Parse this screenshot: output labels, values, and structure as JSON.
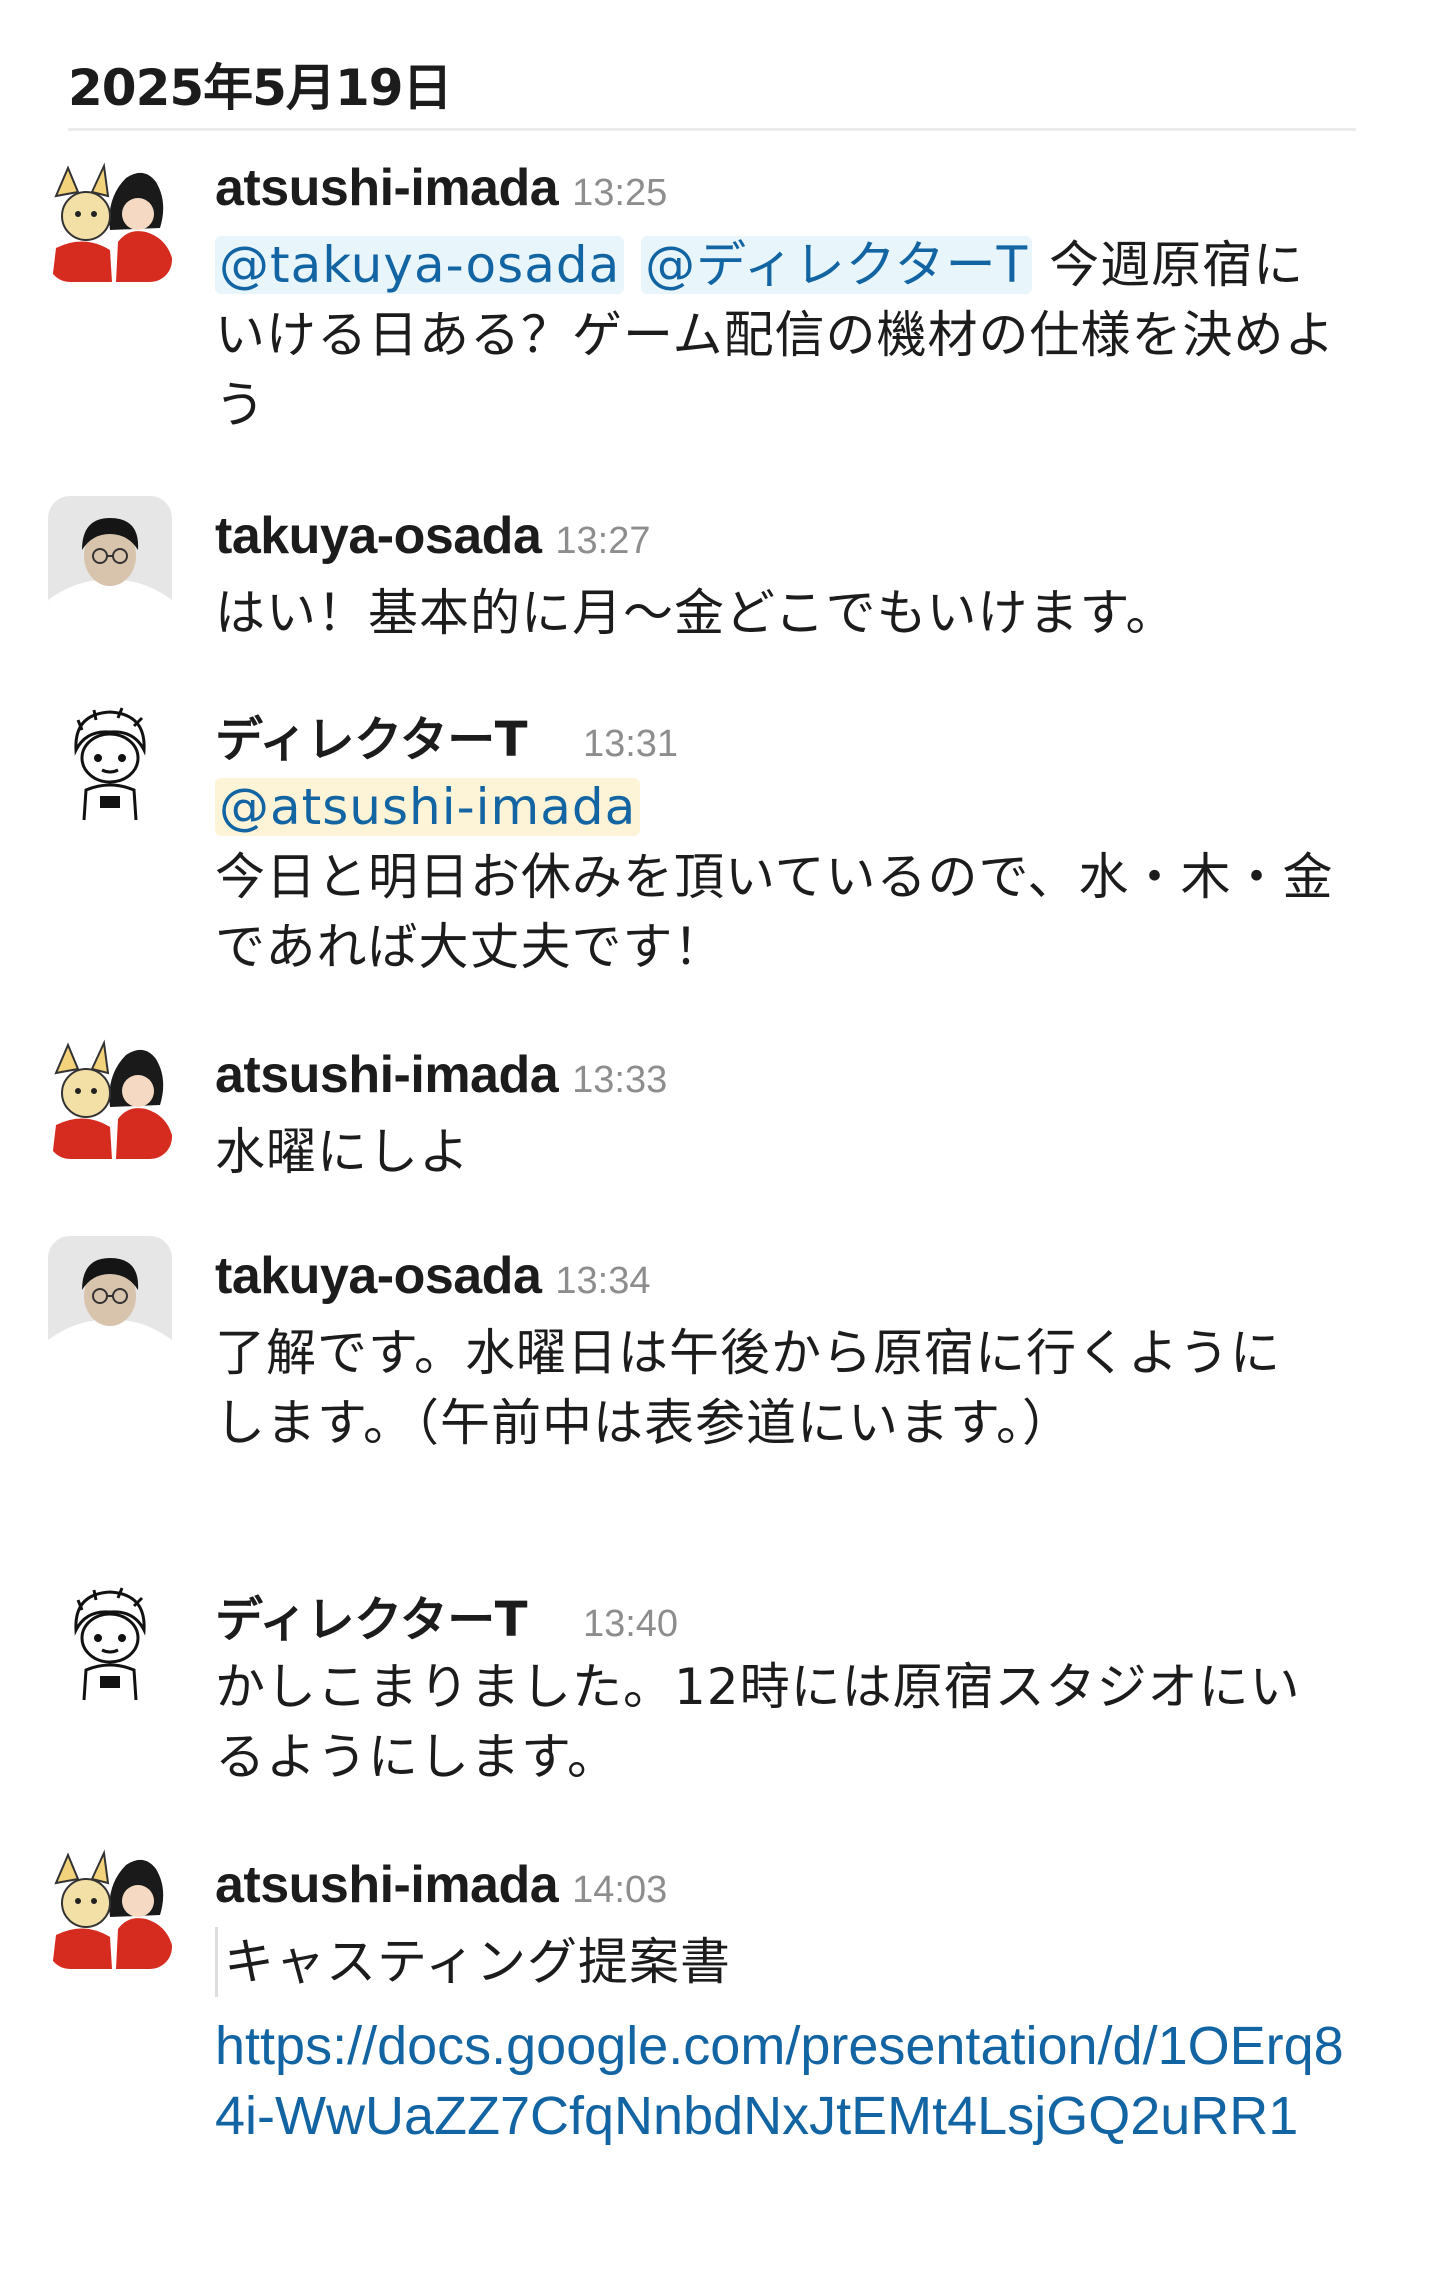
{
  "date_header": "2025年5月19日",
  "messages": [
    {
      "sender": "atsushi-imada",
      "time": "13:25",
      "avatar": "illustrated-pair-avatar",
      "mentions": [
        "@takuya-osada",
        "@ディレクターT"
      ],
      "text": "今週原宿にいける日ある？ゲーム配信の機材の仕様を決めよう"
    },
    {
      "sender": "takuya-osada",
      "time": "13:27",
      "avatar": "photo-avatar",
      "text": "はい！基本的に月〜金どこでもいけます。"
    },
    {
      "sender": "ディレクターT",
      "time": "13:31",
      "avatar": "sketch-avatar",
      "mentions": [
        "@atsushi-imada"
      ],
      "text": "今日と明日お休みを頂いているので、水・木・金であれば大丈夫です！"
    },
    {
      "sender": "atsushi-imada",
      "time": "13:33",
      "avatar": "illustrated-pair-avatar",
      "text": "水曜にしよ"
    },
    {
      "sender": "takuya-osada",
      "time": "13:34",
      "avatar": "photo-avatar",
      "text": "了解です。水曜日は午後から原宿に行くようにします。（午前中は表参道にいます。）"
    },
    {
      "sender": "ディレクターT",
      "time": "13:40",
      "avatar": "sketch-avatar",
      "text": "かしこまりました。12時には原宿スタジオにいるようにします。"
    },
    {
      "sender": "atsushi-imada",
      "time": "14:03",
      "avatar": "illustrated-pair-avatar",
      "text": "キャスティング提案書",
      "link": "https://docs.google.com/presentation/d/1OErq84i-WwUaZZ7CfqNnbdNxJtEMt4LsjGQ2uRR1"
    }
  ],
  "colors": {
    "mention_text": "#1264a3",
    "mention_bg": "#e8f5fa",
    "mention_self_bg": "#fdf3d7",
    "timestamp": "#8d8d8d",
    "text": "#1d1c1d"
  }
}
